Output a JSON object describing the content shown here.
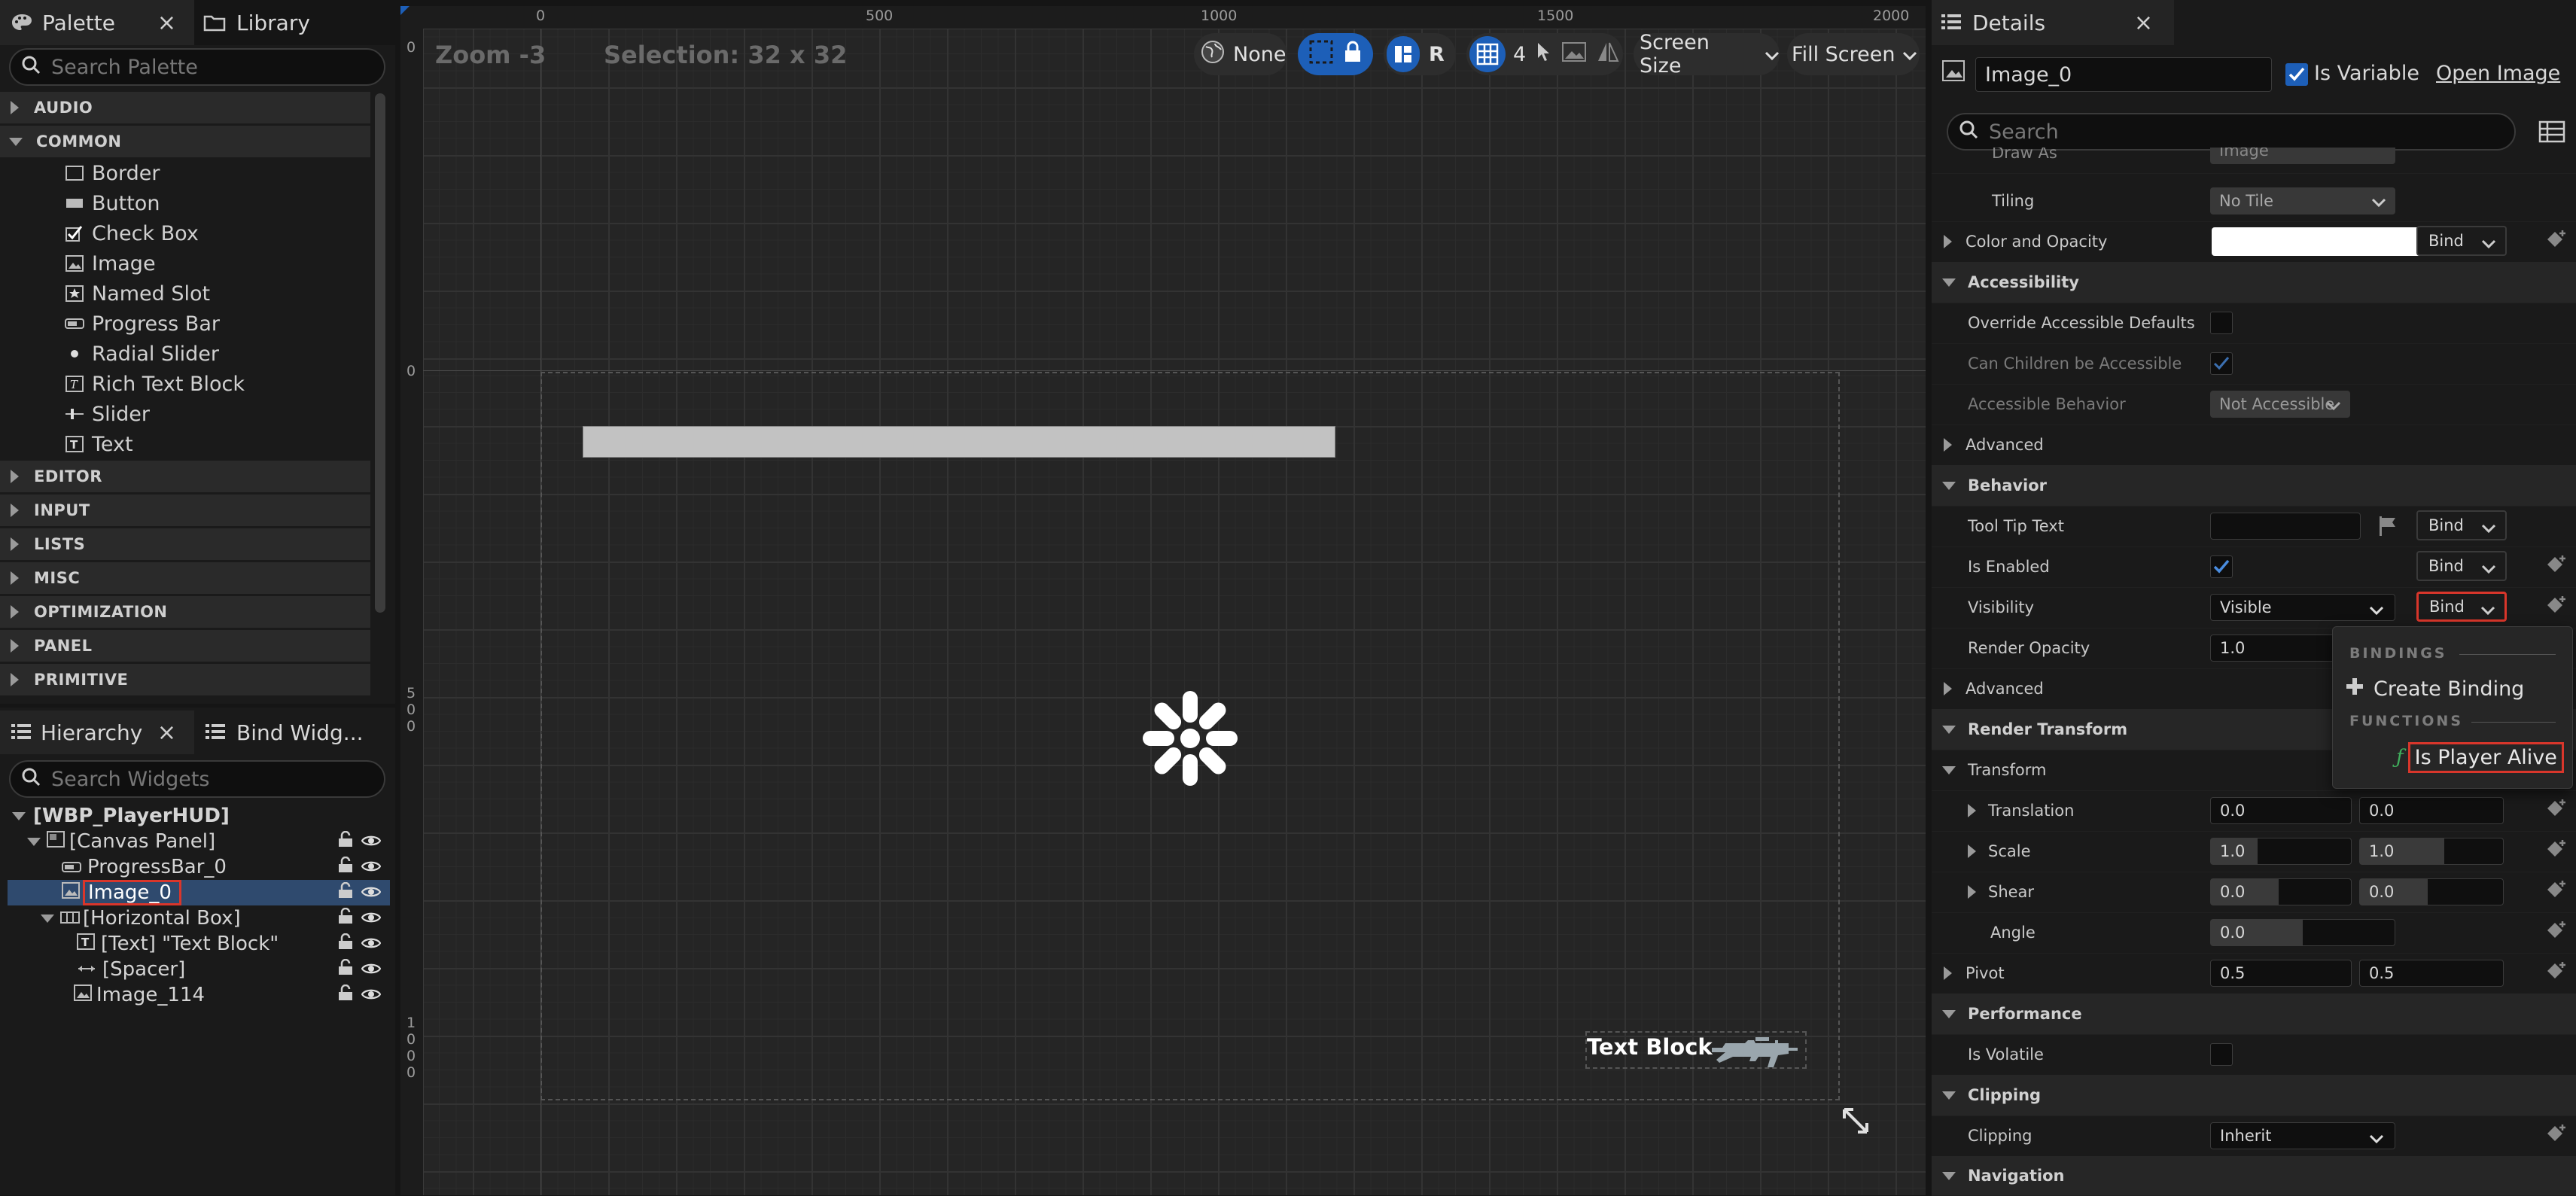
{
  "palette": {
    "tab_label": "Palette",
    "library_tab_label": "Library",
    "search_placeholder": "Search Palette",
    "categories": {
      "audio": "AUDIO",
      "common": "COMMON",
      "editor": "EDITOR",
      "input": "INPUT",
      "lists": "LISTS",
      "misc": "MISC",
      "optimization": "OPTIMIZATION",
      "panel": "PANEL",
      "primitive": "PRIMITIVE"
    },
    "items": {
      "border": "Border",
      "button": "Button",
      "checkbox": "Check Box",
      "image": "Image",
      "named_slot": "Named Slot",
      "progress_bar": "Progress Bar",
      "radial_slider": "Radial Slider",
      "rich_text_block": "Rich Text Block",
      "slider": "Slider",
      "text": "Text"
    }
  },
  "hierarchy": {
    "tab_label": "Hierarchy",
    "bind_widgets_tab_label": "Bind Widg...",
    "search_placeholder": "Search Widgets",
    "root": "[WBP_PlayerHUD]",
    "canvas_panel": "[Canvas Panel]",
    "progress_bar": "ProgressBar_0",
    "image_0": "Image_0",
    "horizontal_box": "[Horizontal Box]",
    "text_block": "[Text] \"Text Block\"",
    "spacer": "[Spacer]",
    "image_114": "Image_114"
  },
  "viewport": {
    "zoom": "Zoom -3",
    "selection": "Selection: 32 x 32",
    "localization": "None",
    "rtl": "R",
    "grid_snap": "4",
    "screen_size": "Screen Size",
    "fill_screen": "Fill Screen",
    "ruler_top": [
      "0",
      "500",
      "1000",
      "1500",
      "2000"
    ],
    "ruler_left_top": "0",
    "ruler_left_origin": "0",
    "ruler_left_500": [
      "5",
      "0",
      "0"
    ],
    "ruler_left_1000": [
      "1",
      "0",
      "0",
      "0"
    ],
    "text_block_label": "Text Block"
  },
  "details": {
    "tab_label": "Details",
    "widget_name": "Image_0",
    "is_variable_label": "Is Variable",
    "open_image": "Open Image",
    "search_placeholder": "Search",
    "draw_as_label": "Draw As",
    "draw_as_value": "Image",
    "tiling_label": "Tiling",
    "tiling_value": "No Tile",
    "color_opacity_label": "Color and Opacity",
    "bind_label": "Bind",
    "accessibility_cat": "Accessibility",
    "override_accessible": "Override Accessible Defaults",
    "can_children": "Can Children be Accessible",
    "accessible_behavior": "Accessible Behavior",
    "accessible_behavior_value": "Not Accessible",
    "advanced": "Advanced",
    "behavior_cat": "Behavior",
    "tooltip_text": "Tool Tip Text",
    "is_enabled": "Is Enabled",
    "visibility": "Visibility",
    "visibility_value": "Visible",
    "render_opacity": "Render Opacity",
    "render_opacity_value": "1.0",
    "render_transform_cat": "Render Transform",
    "transform": "Transform",
    "translation": "Translation",
    "translation_x": "0.0",
    "translation_y": "0.0",
    "scale": "Scale",
    "scale_x": "1.0",
    "scale_y": "1.0",
    "shear": "Shear",
    "shear_x": "0.0",
    "shear_y": "0.0",
    "angle": "Angle",
    "angle_value": "0.0",
    "pivot": "Pivot",
    "pivot_x": "0.5",
    "pivot_y": "0.5",
    "performance_cat": "Performance",
    "is_volatile": "Is Volatile",
    "clipping_cat": "Clipping",
    "clipping": "Clipping",
    "clipping_value": "Inherit",
    "navigation_cat": "Navigation"
  },
  "bind_menu": {
    "bindings_header": "BINDINGS",
    "create_binding": "Create Binding",
    "functions_header": "FUNCTIONS",
    "is_player_alive": "Is Player Alive"
  },
  "colors": {
    "accent_blue": "#1d5fb8",
    "highlight_red": "#d9362b",
    "selected_row": "#2f4a6e"
  }
}
